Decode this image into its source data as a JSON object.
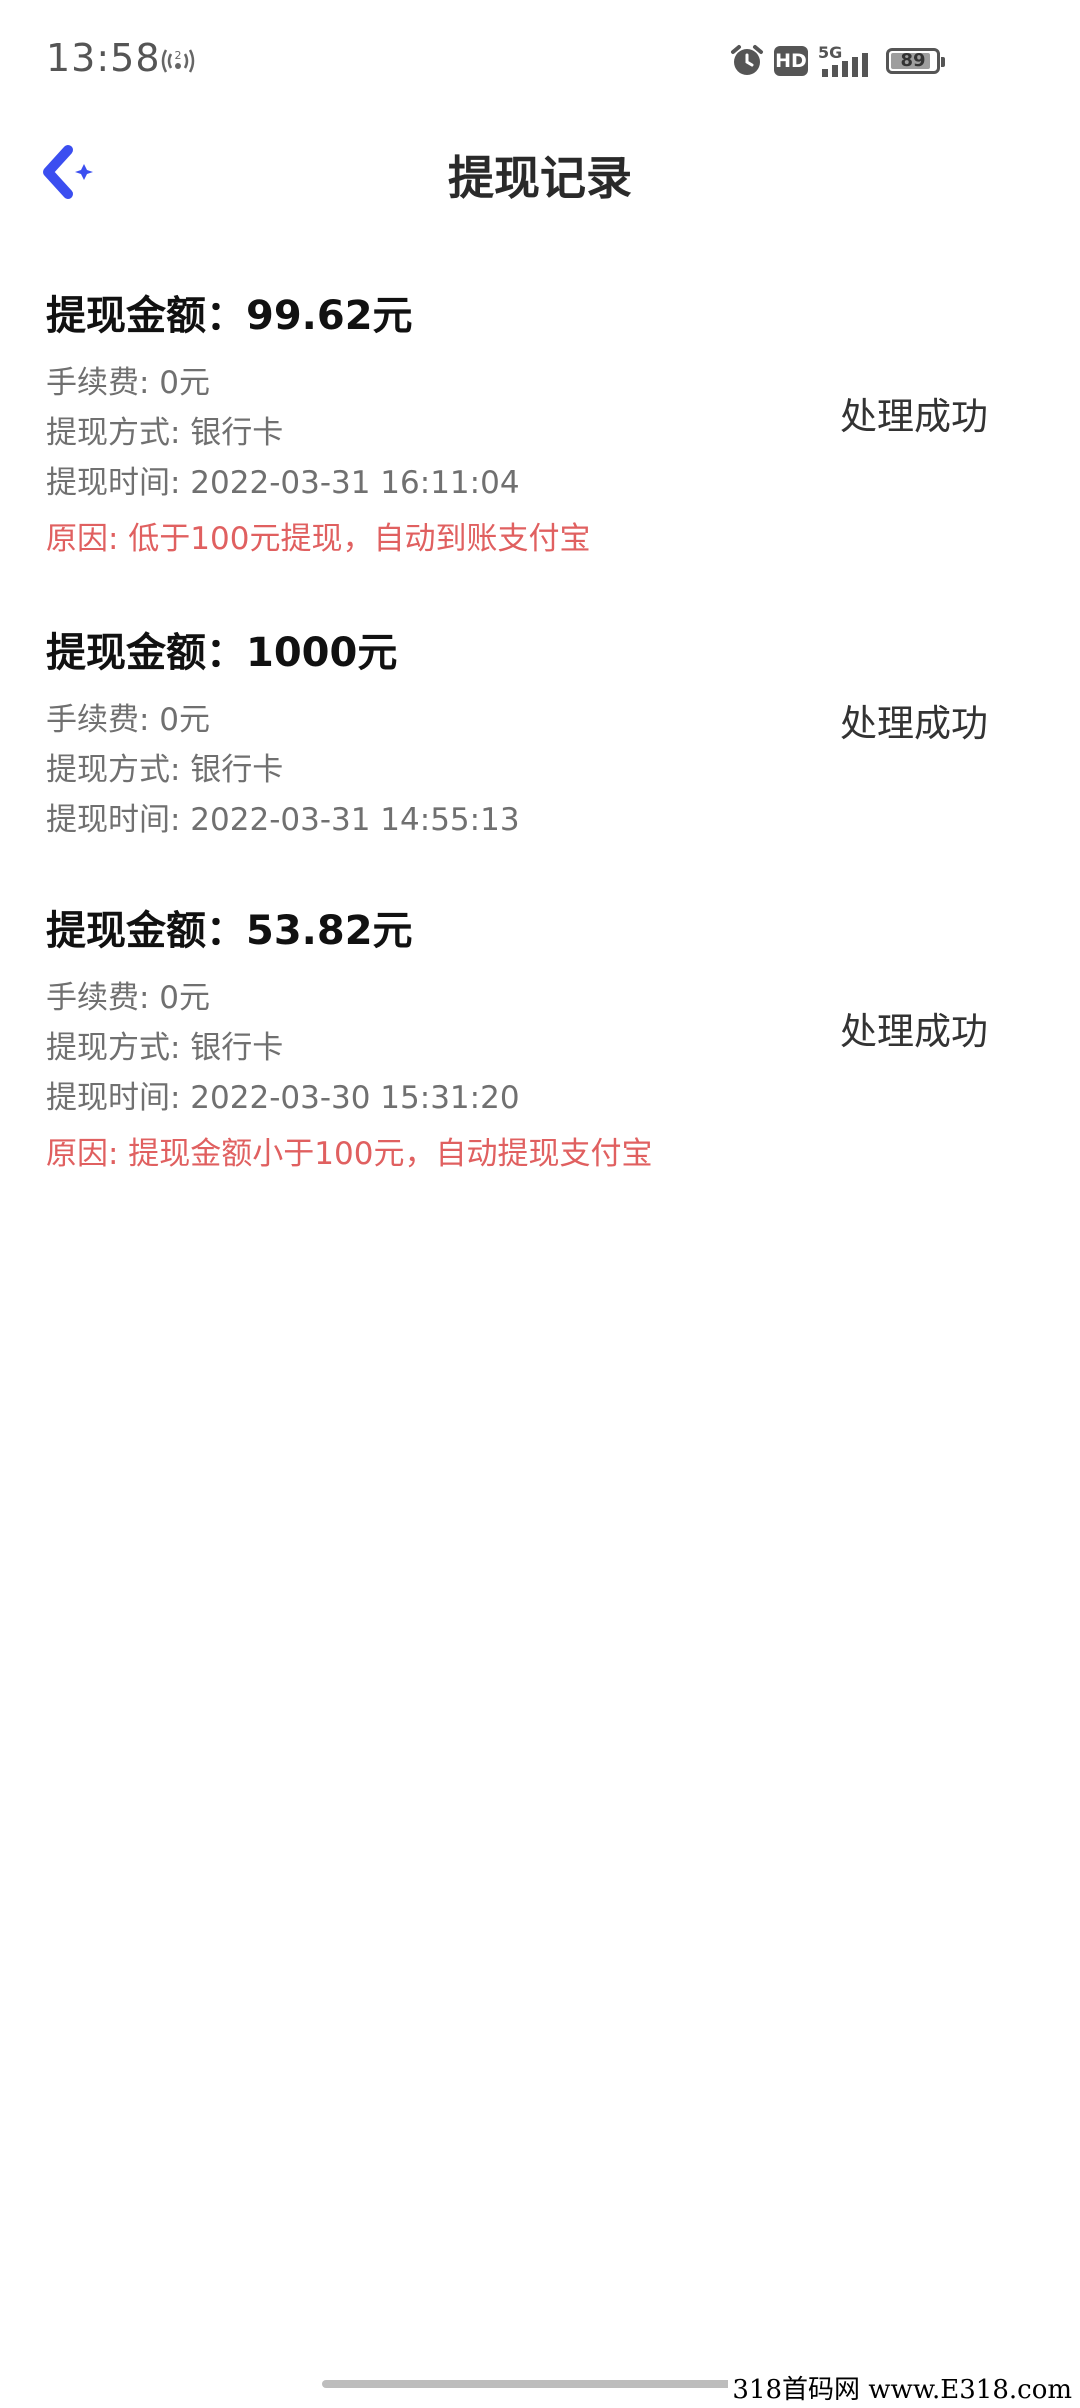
{
  "status_bar": {
    "time": "13:58",
    "hd": "HD",
    "network": "5G",
    "battery": "89",
    "battery_fraction": 0.89
  },
  "header": {
    "title": "提现记录"
  },
  "records": [
    {
      "amount": "提现金额：99.62元",
      "fee": "手续费: 0元",
      "method": "提现方式: 银行卡",
      "time": "提现时间: 2022-03-31 16:11:04",
      "reason": "原因: 低于100元提现，自动到账支付宝",
      "status": "处理成功"
    },
    {
      "amount": "提现金额：1000元",
      "fee": "手续费: 0元",
      "method": "提现方式: 银行卡",
      "time": "提现时间: 2022-03-31 14:55:13",
      "reason": "",
      "status": "处理成功"
    },
    {
      "amount": "提现金额：53.82元",
      "fee": "手续费: 0元",
      "method": "提现方式: 银行卡",
      "time": "提现时间: 2022-03-30 15:31:20",
      "reason": "原因: 提现金额小于100元，自动提现支付宝",
      "status": "处理成功"
    }
  ],
  "watermark": "318首码网 www.E318.com",
  "colors": {
    "accent": "#3b4ef0",
    "reason_text": "#e06060",
    "secondary_text": "#707070"
  }
}
